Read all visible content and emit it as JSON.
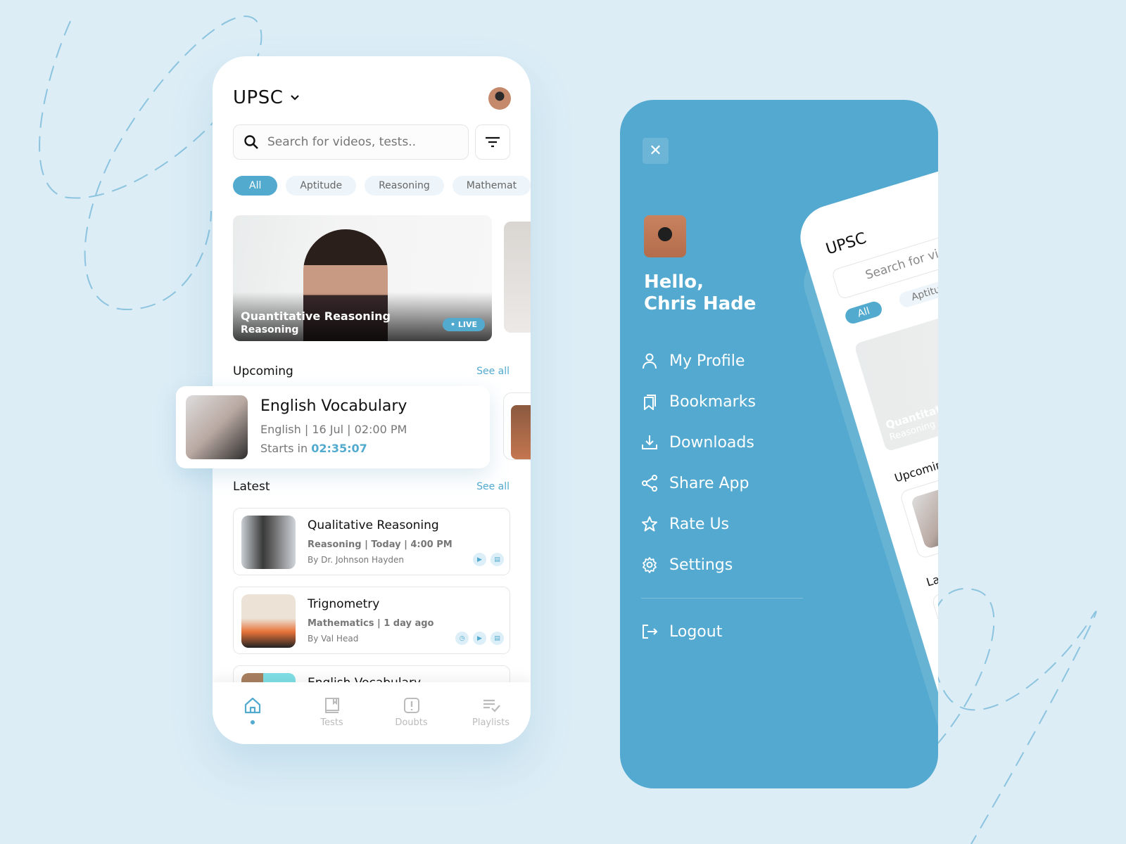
{
  "colors": {
    "accent": "#52aacf",
    "background": "#dcedf6"
  },
  "home": {
    "exam": "UPSC",
    "search_placeholder": "Search for videos, tests..",
    "chips": [
      "All",
      "Aptitude",
      "Reasoning",
      "Mathemat"
    ],
    "featured": {
      "title": "Quantitative Reasoning",
      "subtitle": "Reasoning",
      "badge": "• LIVE"
    },
    "upcoming": {
      "label": "Upcoming",
      "see_all": "See all",
      "card": {
        "title": "English Vocabulary",
        "meta": "English | 16 Jul | 02:00 PM",
        "starts_label": "Starts in",
        "countdown": "02:35:07"
      }
    },
    "latest": {
      "label": "Latest",
      "see_all": "See all",
      "items": [
        {
          "title": "Qualitative Reasoning",
          "meta": "Reasoning | Today | 4:00 PM",
          "author": "By Dr. Johnson Hayden",
          "actions": [
            "play-icon",
            "pdf-icon"
          ]
        },
        {
          "title": "Trignometry",
          "meta": "Mathematics | 1 day ago",
          "author": "By Val Head",
          "actions": [
            "timer-icon",
            "play-icon",
            "pdf-icon"
          ]
        },
        {
          "title": "English Vocabulary"
        }
      ]
    },
    "nav": [
      {
        "label": "",
        "icon": "home-icon",
        "active": true
      },
      {
        "label": "Tests",
        "icon": "book-icon"
      },
      {
        "label": "Doubts",
        "icon": "alert-icon"
      },
      {
        "label": "Playlists",
        "icon": "playlist-icon"
      }
    ]
  },
  "drawer": {
    "greeting": "Hello,",
    "user": "Chris Hade",
    "menu": [
      {
        "label": "My Profile",
        "icon": "user-icon"
      },
      {
        "label": "Bookmarks",
        "icon": "bookmark-icon"
      },
      {
        "label": "Downloads",
        "icon": "download-icon"
      },
      {
        "label": "Share App",
        "icon": "share-icon"
      },
      {
        "label": "Rate Us",
        "icon": "star-icon"
      },
      {
        "label": "Settings",
        "icon": "gear-icon"
      }
    ],
    "logout": "Logout",
    "preview": {
      "exam": "UPSC",
      "search": "Search for vide",
      "chips": [
        "All",
        "Aptitude"
      ],
      "featured_title": "Quantitative",
      "featured_subtitle": "Reasoning",
      "upcoming": "Upcoming",
      "latest": "Latest"
    }
  }
}
